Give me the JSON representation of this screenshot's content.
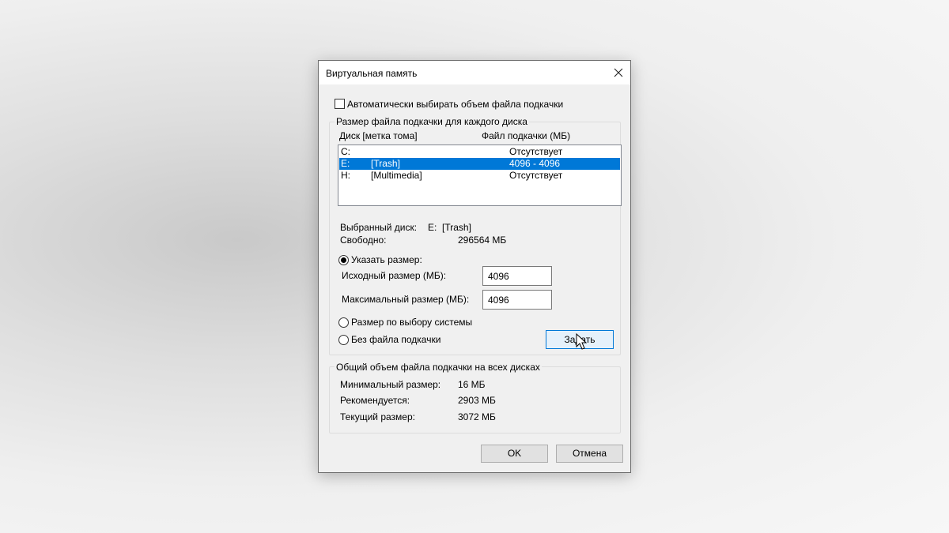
{
  "dialog": {
    "title": "Виртуальная память",
    "auto_checkbox": {
      "label": "Автоматически выбирать объем файла подкачки",
      "checked": false
    },
    "per_disk_group": {
      "title": "Размер файла подкачки для каждого диска",
      "columns": [
        "Диск [метка тома]",
        "Файл подкачки (МБ)"
      ],
      "drives": [
        {
          "letter": "C:",
          "label": "",
          "paging": "Отсутствует",
          "selected": false
        },
        {
          "letter": "E:",
          "label": "[Trash]",
          "paging": "4096 - 4096",
          "selected": true
        },
        {
          "letter": "H:",
          "label": "[Multimedia]",
          "paging": "Отсутствует",
          "selected": false
        }
      ],
      "selected_drive_label": "Выбранный диск:",
      "selected_drive_value": "E:  [Trash]",
      "free_label": "Свободно:",
      "free_value": "296564 МБ",
      "custom_size_radio": "Указать размер:",
      "initial_size_label": "Исходный размер (МБ):",
      "initial_size_value": "4096",
      "max_size_label": "Максимальный размер (МБ):",
      "max_size_value": "4096",
      "system_managed_radio": "Размер по выбору системы",
      "no_paging_radio": "Без файла подкачки",
      "selected_option": "custom",
      "set_button": "Задать"
    },
    "total_group": {
      "title": "Общий объем файла подкачки на всех дисках",
      "rows": [
        {
          "label": "Минимальный размер:",
          "value": "16 МБ"
        },
        {
          "label": "Рекомендуется:",
          "value": "2903 МБ"
        },
        {
          "label": "Текущий размер:",
          "value": "3072 МБ"
        }
      ]
    },
    "ok_button": "OK",
    "cancel_button": "Отмена"
  }
}
